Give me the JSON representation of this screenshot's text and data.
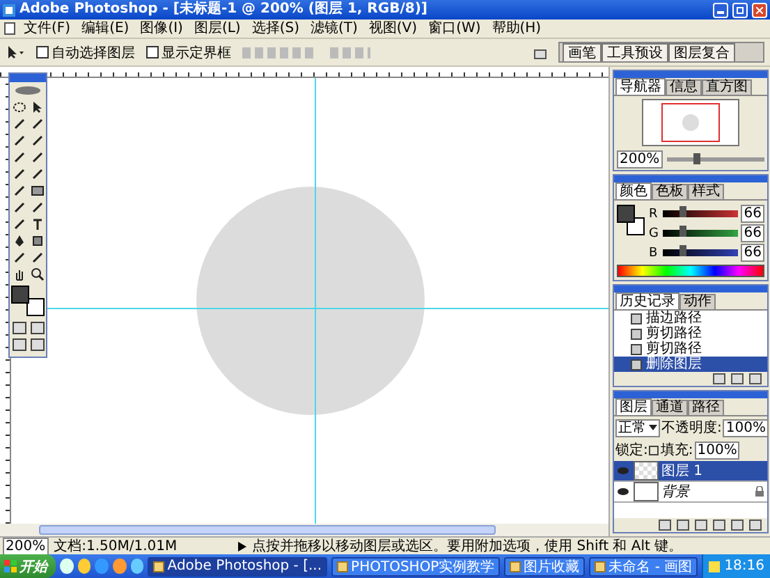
{
  "window": {
    "title": "Adobe Photoshop - [未标题-1 @ 200% (图层 1, RGB/8)]"
  },
  "menu": [
    "文件(F)",
    "编辑(E)",
    "图像(I)",
    "图层(L)",
    "选择(S)",
    "滤镜(T)",
    "视图(V)",
    "窗口(W)",
    "帮助(H)"
  ],
  "options_bar": {
    "checkboxes": [
      {
        "label": "自动选择图层",
        "checked": false
      },
      {
        "label": "显示定界框",
        "checked": false
      }
    ],
    "panel_bin_tabs": [
      "画笔",
      "工具预设",
      "图层复合"
    ]
  },
  "navigator": {
    "tabs": [
      {
        "label": "导航器",
        "selected": true
      },
      {
        "label": "信息",
        "selected": false
      },
      {
        "label": "直方图",
        "selected": false
      }
    ],
    "zoom": "200%",
    "level": 0.3
  },
  "color": {
    "tabs": [
      {
        "label": "颜色",
        "selected": true
      },
      {
        "label": "色板",
        "selected": false
      },
      {
        "label": "样式",
        "selected": false
      }
    ],
    "channels": [
      {
        "label": "R",
        "value": "66",
        "level": 0.26,
        "color": "#c83232"
      },
      {
        "label": "G",
        "value": "66",
        "level": 0.26,
        "color": "#32a040"
      },
      {
        "label": "B",
        "value": "66",
        "level": 0.26,
        "color": "#3040b0"
      }
    ]
  },
  "history": {
    "tabs": [
      {
        "label": "历史记录",
        "selected": true
      },
      {
        "label": "动作",
        "selected": false
      }
    ],
    "items": [
      {
        "label": "描边路径",
        "selected": false
      },
      {
        "label": "剪切路径",
        "selected": false
      },
      {
        "label": "剪切路径",
        "selected": false
      },
      {
        "label": "删除图层",
        "selected": true
      }
    ]
  },
  "layers": {
    "tabs": [
      {
        "label": "图层",
        "selected": true
      },
      {
        "label": "通道",
        "selected": false
      },
      {
        "label": "路径",
        "selected": false
      }
    ],
    "blend_mode": "正常",
    "opacity_label": "不透明度:",
    "opacity": "100%",
    "lock_label": "锁定:",
    "fill_label": "填充:",
    "fill": "100%",
    "items": [
      {
        "name": "图层 1",
        "selected": true,
        "visible": true,
        "locked": false,
        "kind": "transparent"
      },
      {
        "name": "背景",
        "selected": false,
        "visible": true,
        "locked": true,
        "kind": "white"
      }
    ]
  },
  "status_bar": {
    "zoom": "200%",
    "doc_size": "文档:1.50M/1.01M",
    "hint": "点按并拖移以移动图层或选区。要用附加选项，使用 Shift 和 Alt 键。"
  },
  "taskbar": {
    "start": "开始",
    "tasks": [
      {
        "label": "Adobe Photoshop - [...",
        "selected": true
      },
      {
        "label": "PHOTOSHOP实例教学",
        "selected": false
      },
      {
        "label": "图片收藏",
        "selected": false
      },
      {
        "label": "未命名 - 画图",
        "selected": false
      }
    ],
    "clock": "18:16"
  }
}
